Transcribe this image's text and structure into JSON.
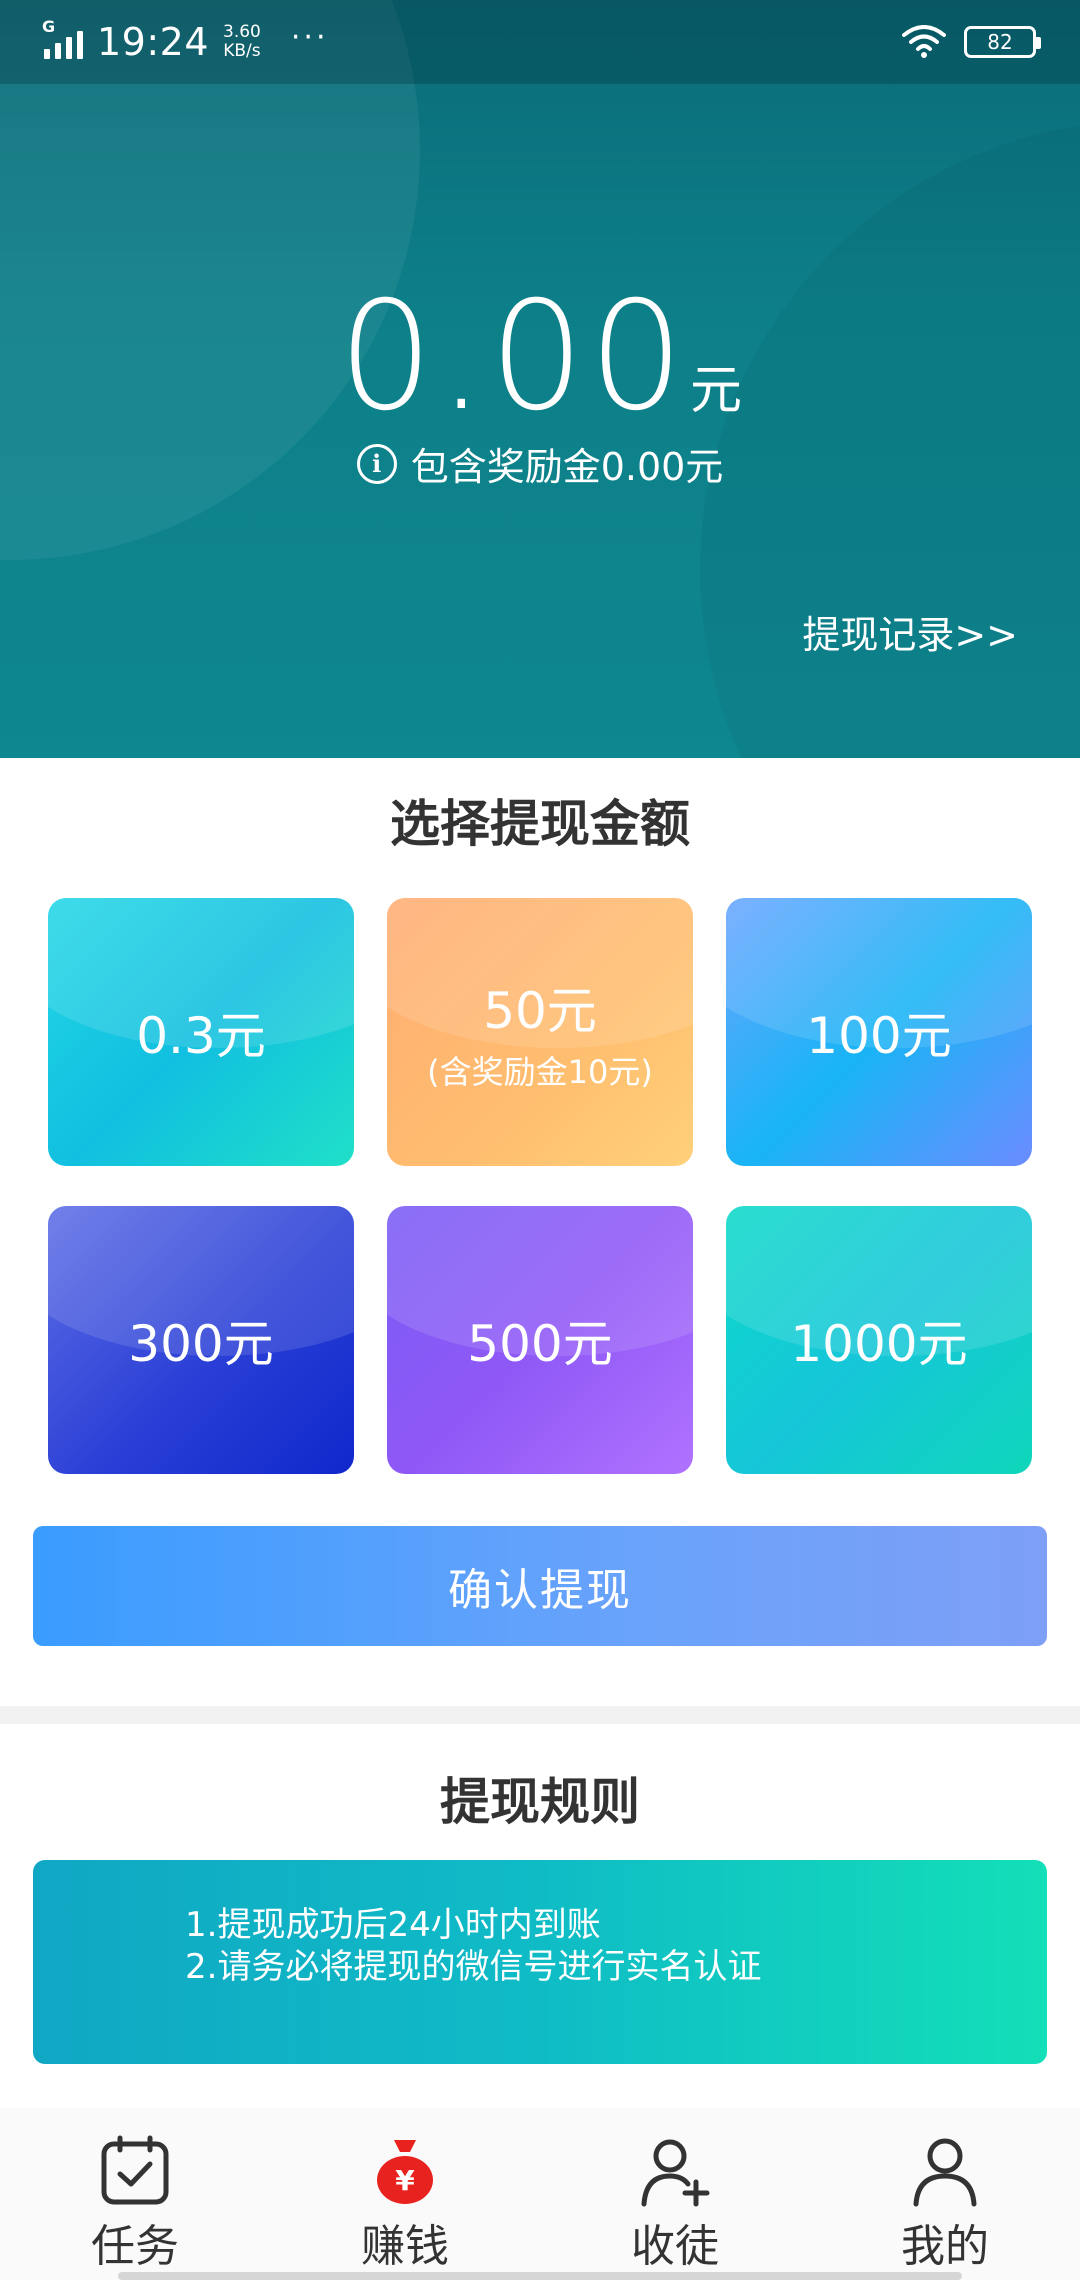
{
  "status_bar": {
    "network": "G",
    "time": "19:24",
    "speed_value": "3.60",
    "speed_unit": "KB/s",
    "dots": "···",
    "battery": "82"
  },
  "balance": {
    "amount": "0.00",
    "unit": "元",
    "bonus_text": "包含奖励金0.00元",
    "record_link": "提现记录>>"
  },
  "select": {
    "title": "选择提现金额",
    "options": [
      {
        "label": "0.3元",
        "sub": ""
      },
      {
        "label": "50元",
        "sub": "(含奖励金10元)"
      },
      {
        "label": "100元",
        "sub": ""
      },
      {
        "label": "300元",
        "sub": ""
      },
      {
        "label": "500元",
        "sub": ""
      },
      {
        "label": "1000元",
        "sub": ""
      }
    ],
    "confirm_label": "确认提现"
  },
  "rules": {
    "title": "提现规则",
    "items": [
      "1.提现成功后24小时内到账",
      "2.请务必将提现的微信号进行实名认证"
    ]
  },
  "nav": {
    "items": [
      {
        "label": "任务",
        "icon": "task-icon"
      },
      {
        "label": "赚钱",
        "icon": "money-bag-icon"
      },
      {
        "label": "收徒",
        "icon": "add-user-icon"
      },
      {
        "label": "我的",
        "icon": "user-icon"
      }
    ]
  },
  "colors": {
    "header": "#0d7f88",
    "active_icon": "#e8231f",
    "confirm": "#5aa0fd"
  }
}
